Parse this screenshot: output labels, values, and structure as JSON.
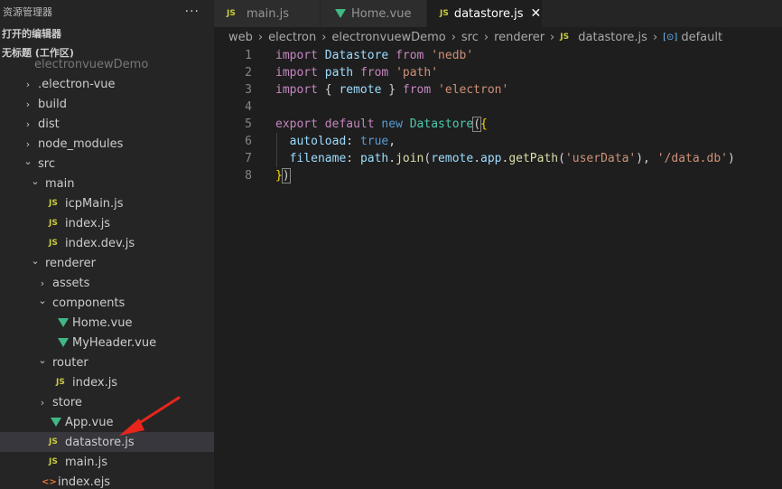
{
  "sidebar": {
    "header_title": "资源管理器",
    "more_label": "···",
    "open_editors_label": "打开的编辑器",
    "workspace_label": "无标题 (工作区)",
    "tree": [
      {
        "label": "electronvuewDemo",
        "type": "folder-faded",
        "depth": 1
      },
      {
        "label": ".electron-vue",
        "type": "folder",
        "state": "collapsed",
        "depth": 1
      },
      {
        "label": "build",
        "type": "folder",
        "state": "collapsed",
        "depth": 1
      },
      {
        "label": "dist",
        "type": "folder",
        "state": "collapsed",
        "depth": 1
      },
      {
        "label": "node_modules",
        "type": "folder",
        "state": "collapsed",
        "depth": 1
      },
      {
        "label": "src",
        "type": "folder",
        "state": "expanded",
        "depth": 1
      },
      {
        "label": "main",
        "type": "folder",
        "state": "expanded",
        "depth": 2
      },
      {
        "label": "icpMain.js",
        "type": "js",
        "depth": 3
      },
      {
        "label": "index.js",
        "type": "js",
        "depth": 3
      },
      {
        "label": "index.dev.js",
        "type": "js",
        "depth": 3
      },
      {
        "label": "renderer",
        "type": "folder",
        "state": "expanded",
        "depth": 2
      },
      {
        "label": "assets",
        "type": "folder",
        "state": "collapsed",
        "depth": 3
      },
      {
        "label": "components",
        "type": "folder",
        "state": "expanded",
        "depth": 3
      },
      {
        "label": "Home.vue",
        "type": "vue",
        "depth": 4
      },
      {
        "label": "MyHeader.vue",
        "type": "vue",
        "depth": 4
      },
      {
        "label": "router",
        "type": "folder",
        "state": "expanded",
        "depth": 3
      },
      {
        "label": "index.js",
        "type": "js",
        "depth": 4
      },
      {
        "label": "store",
        "type": "folder",
        "state": "collapsed",
        "depth": 3
      },
      {
        "label": "App.vue",
        "type": "vue",
        "depth": 3
      },
      {
        "label": "datastore.js",
        "type": "js",
        "depth": 3,
        "selected": true
      },
      {
        "label": "main.js",
        "type": "js",
        "depth": 3
      },
      {
        "label": "index.ejs",
        "type": "ejs",
        "depth": 2
      }
    ]
  },
  "icons": {
    "js": "JS",
    "ejs": "<>",
    "chevron_right": "›",
    "chevron_down": "⌄",
    "close": "✕",
    "symbol": "[⊙]"
  },
  "tabs": [
    {
      "label": "main.js",
      "type": "js"
    },
    {
      "label": "Home.vue",
      "type": "vue"
    },
    {
      "label": "datastore.js",
      "type": "js",
      "active": true
    }
  ],
  "breadcrumbs": [
    "web",
    "electron",
    "electronvuewDemo",
    "src",
    "renderer",
    "datastore.js",
    "default"
  ],
  "code_lines": [
    [
      {
        "t": "import ",
        "c": "kw"
      },
      {
        "t": "Datastore ",
        "c": "var"
      },
      {
        "t": "from ",
        "c": "kw"
      },
      {
        "t": "'nedb'",
        "c": "str"
      }
    ],
    [
      {
        "t": "import ",
        "c": "kw"
      },
      {
        "t": "path ",
        "c": "var"
      },
      {
        "t": "from ",
        "c": "kw"
      },
      {
        "t": "'path'",
        "c": "str"
      }
    ],
    [
      {
        "t": "import ",
        "c": "kw"
      },
      {
        "t": "{ ",
        "c": "punc"
      },
      {
        "t": "remote ",
        "c": "var"
      },
      {
        "t": "} ",
        "c": "punc"
      },
      {
        "t": "from ",
        "c": "kw"
      },
      {
        "t": "'electron'",
        "c": "str"
      }
    ],
    [],
    [
      {
        "t": "export ",
        "c": "kw"
      },
      {
        "t": "default ",
        "c": "kw"
      },
      {
        "t": "new ",
        "c": "kwb"
      },
      {
        "t": "Datastore",
        "c": "cls"
      },
      {
        "t": "(",
        "c": "brk-hl"
      },
      {
        "t": "{",
        "c": "brk"
      }
    ],
    [
      {
        "t": "  ",
        "c": "punc"
      },
      {
        "t": "autoload",
        "c": "var"
      },
      {
        "t": ": ",
        "c": "punc"
      },
      {
        "t": "true",
        "c": "kwb"
      },
      {
        "t": ",",
        "c": "punc"
      }
    ],
    [
      {
        "t": "  ",
        "c": "punc"
      },
      {
        "t": "filename",
        "c": "var"
      },
      {
        "t": ": ",
        "c": "punc"
      },
      {
        "t": "path",
        "c": "var"
      },
      {
        "t": ".",
        "c": "punc"
      },
      {
        "t": "join",
        "c": "fn"
      },
      {
        "t": "(",
        "c": "punc"
      },
      {
        "t": "remote",
        "c": "var"
      },
      {
        "t": ".",
        "c": "punc"
      },
      {
        "t": "app",
        "c": "var"
      },
      {
        "t": ".",
        "c": "punc"
      },
      {
        "t": "getPath",
        "c": "fn"
      },
      {
        "t": "(",
        "c": "punc"
      },
      {
        "t": "'userData'",
        "c": "str"
      },
      {
        "t": "), ",
        "c": "punc"
      },
      {
        "t": "'/data.db'",
        "c": "str"
      },
      {
        "t": ")",
        "c": "punc"
      }
    ],
    [
      {
        "t": "}",
        "c": "brk"
      },
      {
        "t": ")",
        "c": "brk-hl"
      }
    ]
  ],
  "colors": {
    "annotation_arrow": "#e8251b",
    "selected_row": "#37373d",
    "editor_bg": "#1e1e1e"
  }
}
